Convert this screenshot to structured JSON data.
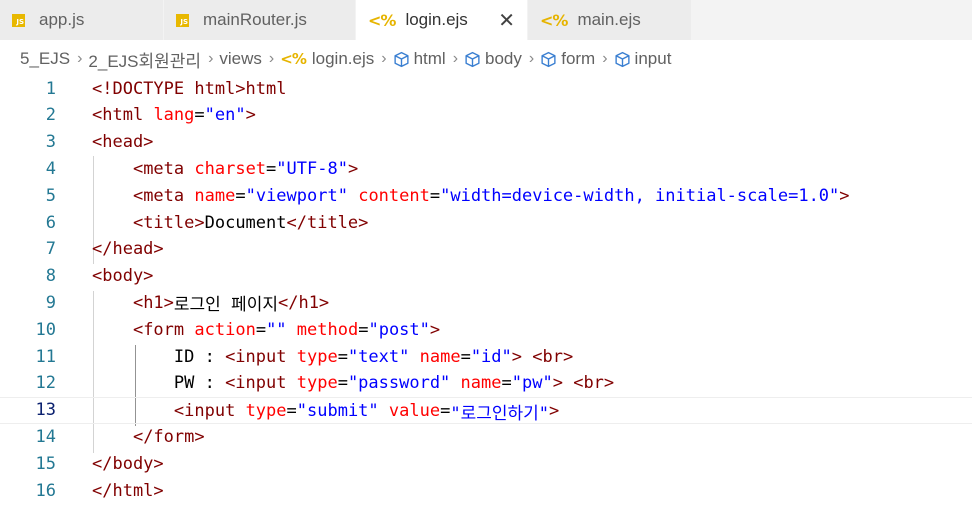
{
  "tabs": [
    {
      "label": "app.js",
      "icon": "js-file-icon",
      "active": false
    },
    {
      "label": "mainRouter.js",
      "icon": "js-file-icon",
      "active": false
    },
    {
      "label": "login.ejs",
      "icon": "ejs-file-icon",
      "active": true
    },
    {
      "label": "main.ejs",
      "icon": "ejs-file-icon",
      "active": false
    }
  ],
  "icons": {
    "js_text": "JS",
    "ejs_glyph": "<%",
    "close_glyph": "✕",
    "chevron": "›"
  },
  "breadcrumb": [
    "5_EJS",
    "2_EJS회원관리",
    "views",
    "login.ejs",
    "html",
    "body",
    "form",
    "input"
  ],
  "editor": {
    "current_line": 13,
    "line_numbers": [
      "1",
      "2",
      "3",
      "4",
      "5",
      "6",
      "7",
      "8",
      "9",
      "10",
      "11",
      "12",
      "13",
      "14",
      "15",
      "16"
    ],
    "lines": [
      [
        [
          "t",
          "<!DOCTYPE html>"
        ],
        [
          "t",
          "html"
        ]
      ],
      [
        [
          "t",
          "<html"
        ],
        [
          "p",
          " "
        ],
        [
          "a",
          "lang"
        ],
        [
          "p",
          "="
        ],
        [
          "v",
          "\"en\""
        ],
        [
          "t",
          ">"
        ]
      ],
      [
        [
          "t",
          "<head>"
        ]
      ],
      [
        [
          "p",
          "    "
        ],
        [
          "t",
          "<meta"
        ],
        [
          "p",
          " "
        ],
        [
          "a",
          "charset"
        ],
        [
          "p",
          "="
        ],
        [
          "v",
          "\"UTF-8\""
        ],
        [
          "t",
          ">"
        ]
      ],
      [
        [
          "p",
          "    "
        ],
        [
          "t",
          "<meta"
        ],
        [
          "p",
          " "
        ],
        [
          "a",
          "name"
        ],
        [
          "p",
          "="
        ],
        [
          "v",
          "\"viewport\""
        ],
        [
          "p",
          " "
        ],
        [
          "a",
          "content"
        ],
        [
          "p",
          "="
        ],
        [
          "v",
          "\"width=device-width, initial-scale=1.0\""
        ],
        [
          "t",
          ">"
        ]
      ],
      [
        [
          "p",
          "    "
        ],
        [
          "t",
          "<title>"
        ],
        [
          "p",
          "Document"
        ],
        [
          "t",
          "</title>"
        ]
      ],
      [
        [
          "t",
          "</head>"
        ]
      ],
      [
        [
          "t",
          "<body>"
        ]
      ],
      [
        [
          "p",
          "    "
        ],
        [
          "t",
          "<h1>"
        ],
        [
          "p",
          "로그인 페이지"
        ],
        [
          "t",
          "</h1>"
        ]
      ],
      [
        [
          "p",
          "    "
        ],
        [
          "t",
          "<form"
        ],
        [
          "p",
          " "
        ],
        [
          "a",
          "action"
        ],
        [
          "p",
          "="
        ],
        [
          "v",
          "\"\""
        ],
        [
          "p",
          " "
        ],
        [
          "a",
          "method"
        ],
        [
          "p",
          "="
        ],
        [
          "v",
          "\"post\""
        ],
        [
          "t",
          ">"
        ]
      ],
      [
        [
          "p",
          "        ID : "
        ],
        [
          "t",
          "<input"
        ],
        [
          "p",
          " "
        ],
        [
          "a",
          "type"
        ],
        [
          "p",
          "="
        ],
        [
          "v",
          "\"text\""
        ],
        [
          "p",
          " "
        ],
        [
          "a",
          "name"
        ],
        [
          "p",
          "="
        ],
        [
          "v",
          "\"id\""
        ],
        [
          "t",
          ">"
        ],
        [
          "p",
          " "
        ],
        [
          "t",
          "<br>"
        ]
      ],
      [
        [
          "p",
          "        PW : "
        ],
        [
          "t",
          "<input"
        ],
        [
          "p",
          " "
        ],
        [
          "a",
          "type"
        ],
        [
          "p",
          "="
        ],
        [
          "v",
          "\"password\""
        ],
        [
          "p",
          " "
        ],
        [
          "a",
          "name"
        ],
        [
          "p",
          "="
        ],
        [
          "v",
          "\"pw\""
        ],
        [
          "t",
          ">"
        ],
        [
          "p",
          " "
        ],
        [
          "t",
          "<br>"
        ]
      ],
      [
        [
          "p",
          "        "
        ],
        [
          "t",
          "<input"
        ],
        [
          "p",
          " "
        ],
        [
          "a",
          "type"
        ],
        [
          "p",
          "="
        ],
        [
          "v",
          "\"submit\""
        ],
        [
          "p",
          " "
        ],
        [
          "a",
          "value"
        ],
        [
          "p",
          "="
        ],
        [
          "v",
          "\"로그인하기\""
        ],
        [
          "t",
          ">"
        ]
      ],
      [
        [
          "p",
          "    "
        ],
        [
          "t",
          "</form>"
        ]
      ],
      [
        [
          "t",
          "</body>"
        ]
      ],
      [
        [
          "t",
          "</html>"
        ]
      ]
    ]
  }
}
